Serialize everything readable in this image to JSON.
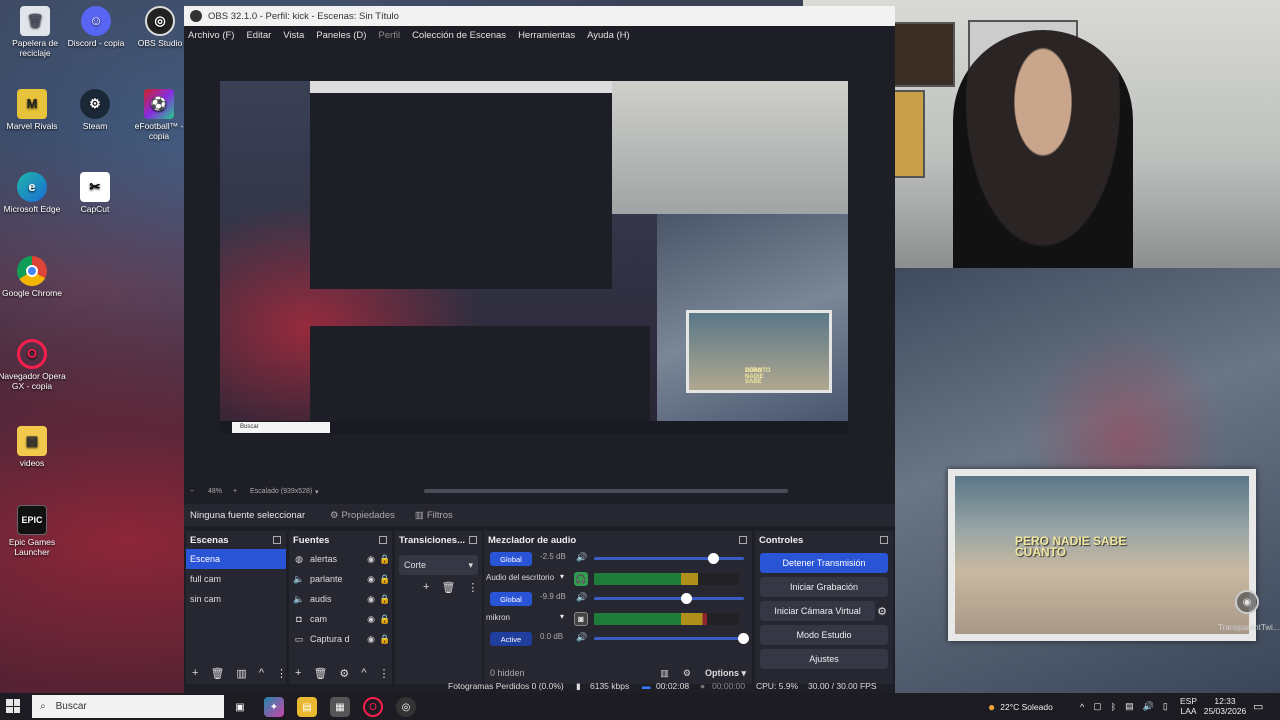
{
  "desktop": {
    "icons": [
      {
        "label": "Papelera de reciclaje",
        "icon": "recycle-bin-icon"
      },
      {
        "label": "Discord - copia",
        "icon": "discord-icon"
      },
      {
        "label": "OBS Studio",
        "icon": "obs-icon"
      },
      {
        "label": "Marvel Rivals",
        "icon": "marvel-rivals-icon"
      },
      {
        "label": "Steam",
        "icon": "steam-icon"
      },
      {
        "label": "eFootball™ - copia",
        "icon": "efootball-icon"
      },
      {
        "label": "Microsoft Edge",
        "icon": "edge-icon"
      },
      {
        "label": "CapCut",
        "icon": "capcut-icon"
      },
      {
        "label": "Google Chrome",
        "icon": "chrome-icon"
      },
      {
        "label": "Navegador Opera GX - copia",
        "icon": "opera-gx-icon"
      },
      {
        "label": "videos",
        "icon": "folder-icon"
      },
      {
        "label": "Epic Games Launcher",
        "icon": "epic-games-icon"
      }
    ]
  },
  "obs": {
    "title": "OBS 32.1.0 - Perfil: kick - Escenas: Sin Título",
    "menu": [
      "Archivo (F)",
      "Editar",
      "Vista",
      "Paneles (D)",
      "Perfil",
      "Colección de Escenas",
      "Herramientas",
      "Ayuda (H)"
    ],
    "preview_status": {
      "zoom": "48%",
      "scale": "Escalado (939x528)"
    },
    "no_source": "Ninguna fuente seleccionar",
    "properties_label": "Propiedades",
    "filters_label": "Filtros",
    "scenes": {
      "title": "Escenas",
      "items": [
        "Escena",
        "full cam",
        "sin cam"
      ],
      "selected": 0
    },
    "sources": {
      "title": "Fuentes",
      "items": [
        {
          "name": "alertas",
          "icon": "browser-source-icon"
        },
        {
          "name": "parlante",
          "icon": "speaker-icon"
        },
        {
          "name": "audis",
          "icon": "speaker-icon"
        },
        {
          "name": "cam",
          "icon": "camera-icon"
        },
        {
          "name": "Captura d",
          "icon": "monitor-icon"
        }
      ]
    },
    "transitions": {
      "title": "Transiciones...",
      "selected": "Corte"
    },
    "mixer": {
      "title": "Mezclador de audio",
      "channels": [
        {
          "button": "Global",
          "db": "-2.5 dB",
          "name": "Audio del escritorio",
          "volume": 0.8,
          "meter_level": 0.72,
          "monitor_color": "#2e9e4f"
        },
        {
          "button": "Global",
          "db": "-9.9 dB",
          "name": "mikron",
          "volume": 0.62,
          "meter_level": 0.78,
          "monitor_color": "#555"
        },
        {
          "button": "Active",
          "db": "0.0 dB",
          "name": "",
          "volume": 1.0,
          "meter_level": 0,
          "monitor_color": ""
        }
      ],
      "hidden_label": "0 hidden",
      "options_label": "Options"
    },
    "controls": {
      "title": "Controles",
      "buttons": [
        "Detener Transmisión",
        "Iniciar Grabación",
        "Iniciar Cámara Virtual",
        "Modo Estudio",
        "Ajustes"
      ]
    },
    "statusbar": {
      "dropped": "Fotogramas Perdidos 0 (0.0%)",
      "bitrate": "6135 kbps",
      "stream_time": "00:02:08",
      "rec_time": "00:00:00",
      "cpu": "CPU: 5.9%",
      "fps": "30.00 / 30.00 FPS"
    }
  },
  "overlay": {
    "caption_line1": "PERO NADIE SABE",
    "caption_line2": "CUANTO",
    "logo_label": "TransparentTwi..."
  },
  "taskbar": {
    "search_placeholder": "Buscar",
    "weather": "22°C  Soleado",
    "lang1": "ESP",
    "lang2": "LAA",
    "time": "12:33",
    "date": "25/03/2026"
  }
}
